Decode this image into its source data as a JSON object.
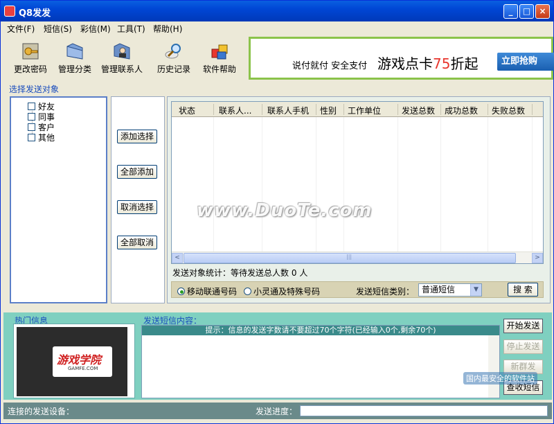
{
  "window": {
    "title": "Q8发发",
    "minimize": "_",
    "maximize": "□",
    "close": "×"
  },
  "menu": [
    "文件(F)",
    "短信(S)",
    "彩信(M)",
    "工具(T)",
    "帮助(H)"
  ],
  "toolbar": [
    {
      "label": "更改密码",
      "icon": "key-icon"
    },
    {
      "label": "管理分类",
      "icon": "folder-icon"
    },
    {
      "label": "管理联系人",
      "icon": "contacts-icon"
    },
    {
      "label": "历史记录",
      "icon": "magnifier-icon"
    },
    {
      "label": "软件帮助",
      "icon": "help-icon"
    }
  ],
  "ad": {
    "slogan": "说付就付  安全支付",
    "main_prefix": "游戏点卡",
    "main_number": "75",
    "main_suffix": "折起",
    "button": "立即抢购"
  },
  "select_targets": {
    "title": "选择发送对象",
    "groups": [
      "好友",
      "同事",
      "客户",
      "其他"
    ]
  },
  "actions": {
    "add_selected": "添加选择",
    "add_all": "全部添加",
    "cancel_selected": "取消选择",
    "cancel_all": "全部取消"
  },
  "grid": {
    "columns": [
      "状态",
      "联系人...",
      "联系人手机",
      "性别",
      "工作单位",
      "发送总数",
      "成功总数",
      "失败总数"
    ],
    "scroll_left": "<",
    "scroll_right": ">",
    "scroll_grip": "|||"
  },
  "stats": {
    "label": "发送对象统计：等待发送总人数",
    "count": "0",
    "unit": "人"
  },
  "filter": {
    "radio_mobile": "移动联通号码",
    "radio_phs": "小灵通及特殊号码",
    "type_label": "发送短信类别：",
    "type_value": "普通短信",
    "search": "搜 索"
  },
  "hot": {
    "title": "热门信息",
    "logo_text": "游戏学院",
    "logo_sub": "GAMFE.COM"
  },
  "compose": {
    "title": "发送短信内容：",
    "hint": "提示：信息的发送字数请不要超过70个字符(已经输入0个,剩余70个)"
  },
  "send_buttons": {
    "start": "开始发送",
    "stop": "停止发送",
    "new": "新群发",
    "inbox": "查收短信"
  },
  "status": {
    "device_label": "连接的发送设备：",
    "progress_label": "发送进度："
  },
  "watermark": "www.DuoTe.com",
  "corner_watermark": "国内最安全的软件站"
}
